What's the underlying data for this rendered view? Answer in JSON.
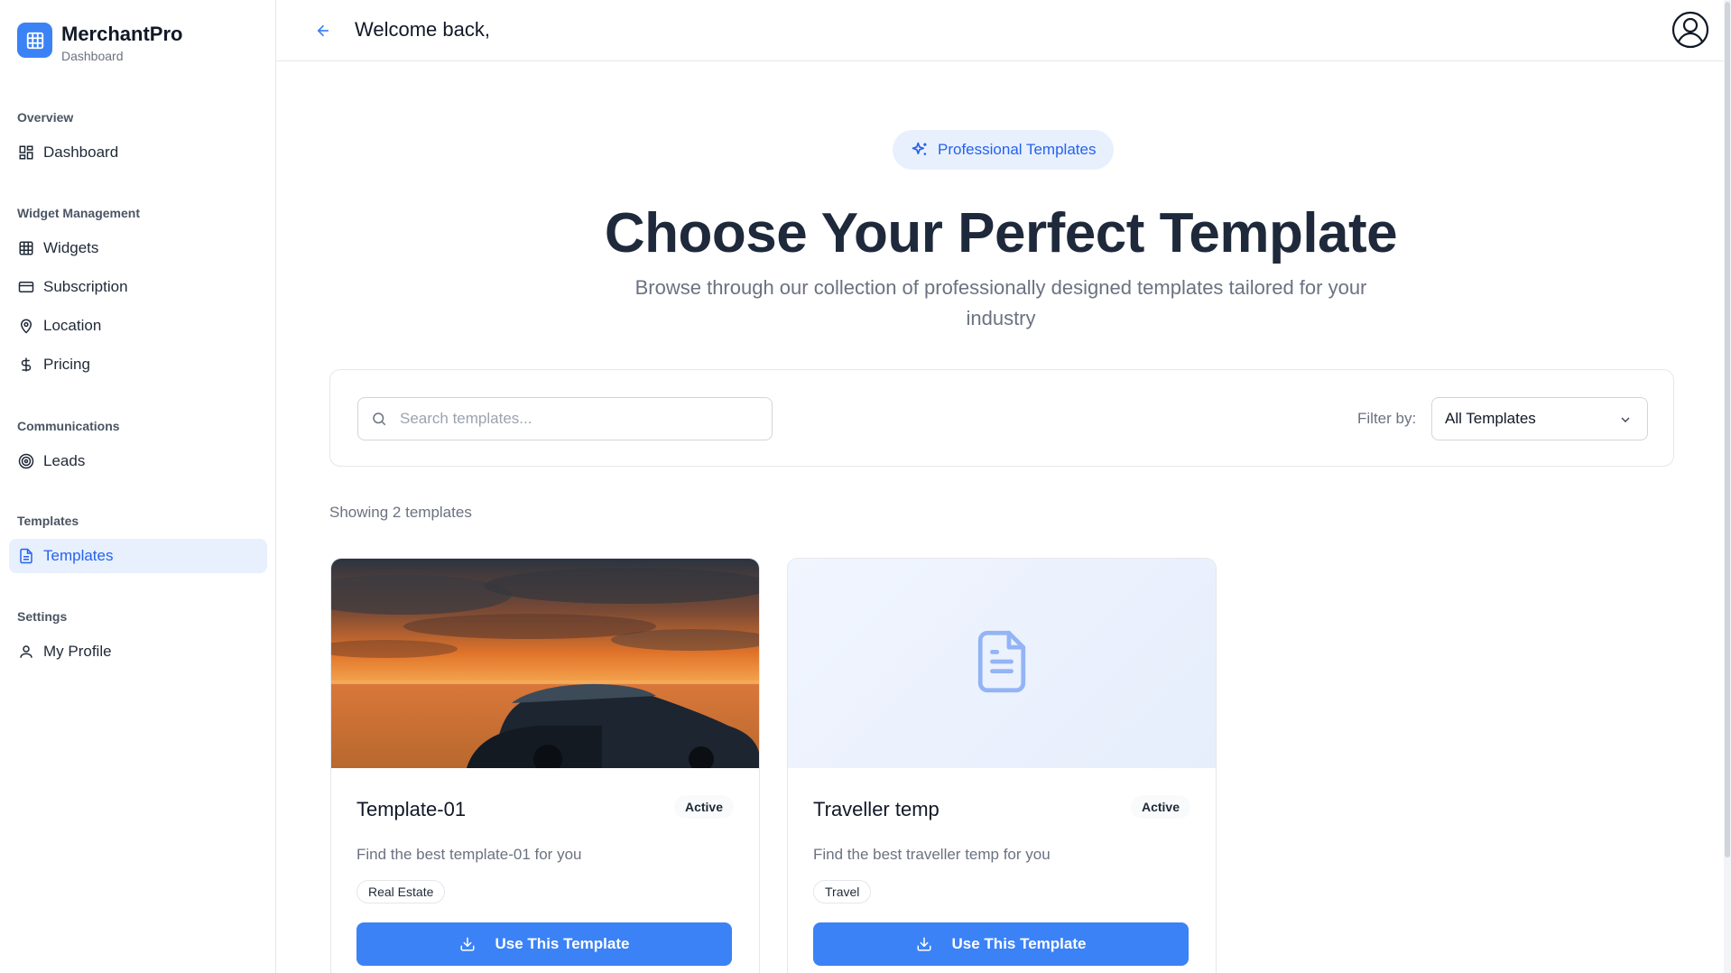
{
  "app": {
    "name": "MerchantPro",
    "subtitle": "Dashboard"
  },
  "sidebar": {
    "sections": [
      {
        "heading": "Overview",
        "items": [
          {
            "label": "Dashboard",
            "icon": "dashboard-grid-icon"
          }
        ]
      },
      {
        "heading": "Widget Management",
        "items": [
          {
            "label": "Widgets",
            "icon": "grid-icon"
          },
          {
            "label": "Subscription",
            "icon": "credit-card-icon"
          },
          {
            "label": "Location",
            "icon": "map-pin-icon"
          },
          {
            "label": "Pricing",
            "icon": "dollar-icon"
          }
        ]
      },
      {
        "heading": "Communications",
        "items": [
          {
            "label": "Leads",
            "icon": "target-icon"
          }
        ]
      },
      {
        "heading": "Templates",
        "items": [
          {
            "label": "Templates",
            "icon": "document-icon",
            "active": true
          }
        ]
      },
      {
        "heading": "Settings",
        "items": [
          {
            "label": "My Profile",
            "icon": "user-icon"
          }
        ]
      }
    ]
  },
  "header": {
    "welcome": "Welcome back,"
  },
  "hero": {
    "badge": "Professional Templates",
    "title": "Choose Your Perfect Template",
    "subtitle": "Browse through our collection of professionally designed templates tailored for your industry"
  },
  "filters": {
    "search_placeholder": "Search templates...",
    "filter_label": "Filter by:",
    "filter_value": "All Templates"
  },
  "results": {
    "count_text": "Showing 2 templates"
  },
  "templates": [
    {
      "title": "Template-01",
      "status": "Active",
      "description": "Find the best template-01 for you",
      "tag": "Real Estate",
      "button": "Use This Template"
    },
    {
      "title": "Traveller temp",
      "status": "Active",
      "description": "Find the best traveller temp for you",
      "tag": "Travel",
      "button": "Use This Template"
    }
  ],
  "colors": {
    "accent": "#3b82f6",
    "accent_text": "#2563eb",
    "active_bg": "#e8f0fe"
  }
}
